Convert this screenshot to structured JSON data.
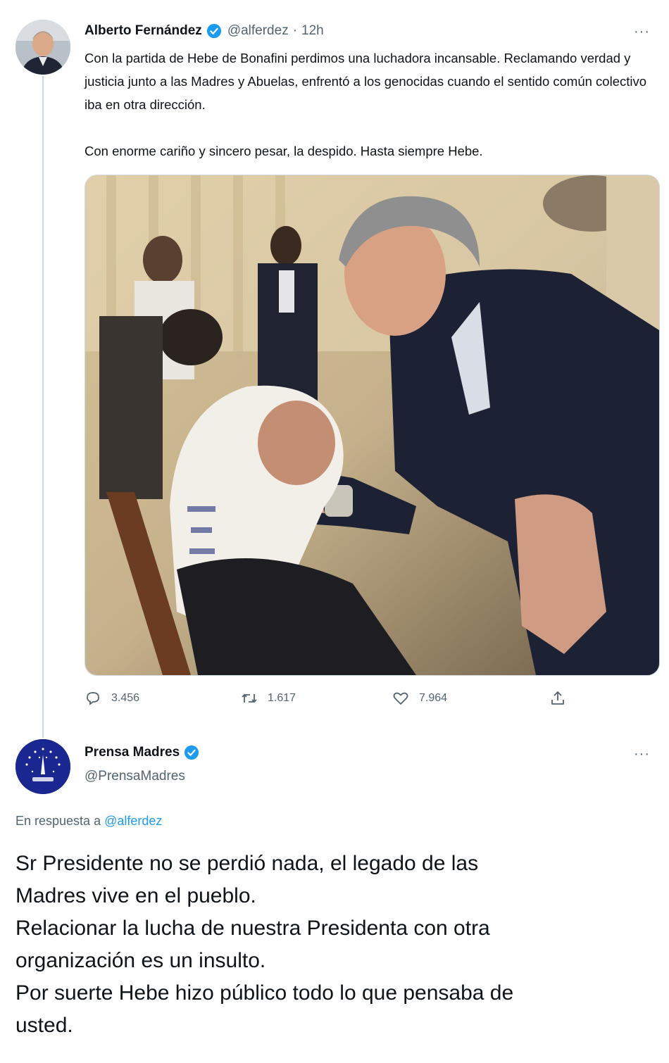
{
  "tweet1": {
    "author_name": "Alberto Fernández",
    "handle": "@alferdez",
    "separator": "·",
    "time": "12h",
    "more": "···",
    "paragraphs": [
      "Con la partida de Hebe de Bonafini perdimos una luchadora incansable. Reclamando verdad y justicia junto a las Madres y Abuelas, enfrentó a los genocidas cuando el sentido común colectivo iba en otra dirección.",
      "Con enorme cariño y sincero pesar, la despido. Hasta siempre Hebe."
    ],
    "stats": {
      "replies": "3.456",
      "retweets": "1.617",
      "likes": "7.964"
    },
    "icons": {
      "reply": "reply-icon",
      "retweet": "retweet-icon",
      "like": "heart-icon",
      "share": "share-icon",
      "verified": "verified-badge-icon"
    }
  },
  "tweet2": {
    "author_name": "Prensa Madres",
    "handle": "@PrensaMadres",
    "more": "···",
    "reply_prefix": "En respuesta a",
    "reply_to": "@alferdez",
    "lines": [
      "Sr Presidente no se perdió nada, el legado de las",
      "Madres vive en el pueblo.",
      "Relacionar la lucha de nuestra Presidenta con otra",
      "organización es un insulto.",
      "Por suerte Hebe hizo público todo lo que pensaba de",
      "usted."
    ]
  },
  "colors": {
    "verified": "#1d9bf0",
    "secondary_text": "#536471",
    "link": "#1d9bf0",
    "thread_line": "#cfd9de"
  }
}
